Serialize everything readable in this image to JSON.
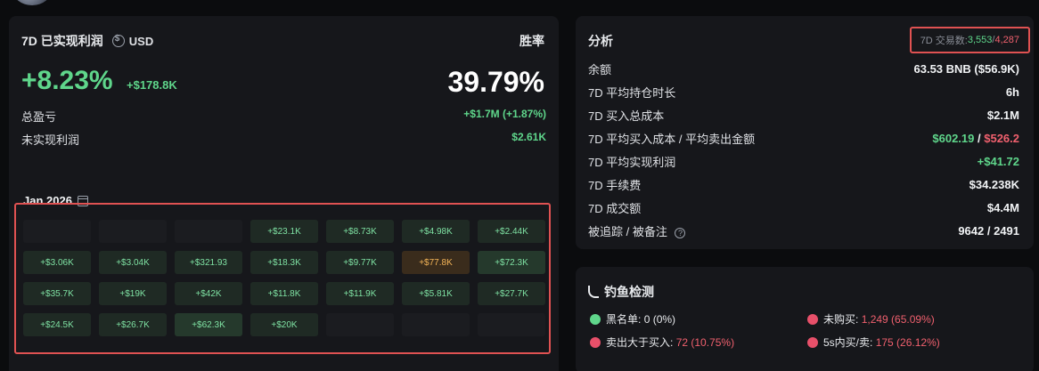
{
  "pnl": {
    "title": "7D 已实现利润",
    "currency": "USD",
    "winrate_label": "胜率",
    "percent": "+8.23%",
    "usd": "+$178.8K",
    "winrate": "39.79%",
    "total_label": "总盈亏",
    "total_value": "+$1.7M (+1.87%)",
    "unrealized_label": "未实现利润",
    "unrealized_value": "$2.61K"
  },
  "calendar": {
    "month": "Jan 2026",
    "rows": [
      [
        "",
        "",
        "",
        "+$23.1K",
        "+$8.73K",
        "+$4.98K",
        "+$2.44K"
      ],
      [
        "+$3.06K",
        "+$3.04K",
        "+$321.93",
        "+$18.3K",
        "+$9.77K",
        "+$77.8K",
        "+$72.3K"
      ],
      [
        "+$35.7K",
        "+$19K",
        "+$42K",
        "+$11.8K",
        "+$11.9K",
        "+$5.81K",
        "+$27.7K"
      ],
      [
        "+$24.5K",
        "+$26.7K",
        "+$62.3K",
        "+$20K",
        "",
        "",
        ""
      ]
    ]
  },
  "analysis": {
    "title": "分析",
    "tx_label": "7D 交易数:",
    "tx_buy": "3,553",
    "tx_sep": "/",
    "tx_sell": "4,287",
    "rows": [
      {
        "label": "余额",
        "value": "63.53 BNB ($56.9K)"
      },
      {
        "label": "7D 平均持仓时长",
        "value": "6h"
      },
      {
        "label": "7D 买入总成本",
        "value": "$2.1M"
      },
      {
        "label": "7D 平均买入成本 / 平均卖出金额",
        "value_buy": "$602.19",
        "value_sep": " / ",
        "value_sell": "$526.2"
      },
      {
        "label": "7D 平均实现利润",
        "value": "+$41.72"
      },
      {
        "label": "7D 手续费",
        "value": "$34.238K"
      },
      {
        "label": "7D 成交额",
        "value": "$4.4M"
      },
      {
        "label": "被追踪 / 被备注",
        "value": "9642 / 2491"
      }
    ]
  },
  "phishing": {
    "title": "钓鱼检测",
    "blacklist_label": "黑名单:",
    "blacklist_value": "0 (0%)",
    "unbought_label": "未购买:",
    "unbought_value": "1,249 (65.09%)",
    "sell_gt_buy_label": "卖出大于买入:",
    "sell_gt_buy_value": "72 (10.75%)",
    "fast_label": "5s内买/卖:",
    "fast_value": "175 (26.12%)"
  },
  "colors": {
    "positive": "#5fd68b",
    "negative": "#f0606e",
    "highlight_border": "#e05252"
  }
}
